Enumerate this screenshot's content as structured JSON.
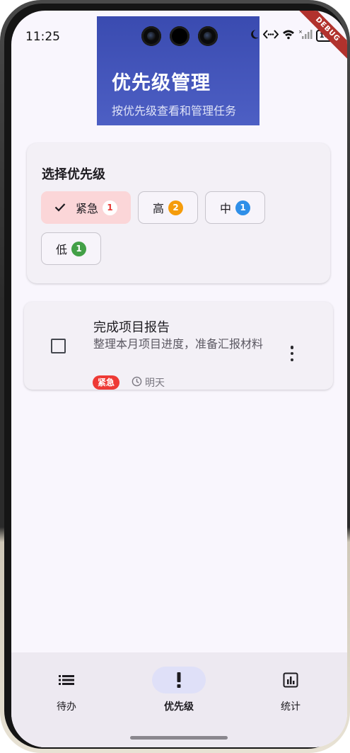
{
  "status_bar": {
    "time": "11:25",
    "battery": "100",
    "debug_banner": "DEBUG"
  },
  "header": {
    "title": "优先级管理",
    "subtitle": "按优先级查看和管理任务"
  },
  "filter": {
    "title": "选择优先级",
    "chips": [
      {
        "label": "紧急",
        "count": "1",
        "selected": true,
        "badge_color": "#ffffff",
        "badge_text_color": "#e53935"
      },
      {
        "label": "高",
        "count": "2",
        "selected": false,
        "badge_color": "#f59c0b",
        "badge_text_color": "#ffffff"
      },
      {
        "label": "中",
        "count": "1",
        "selected": false,
        "badge_color": "#2f8fe8",
        "badge_text_color": "#ffffff"
      },
      {
        "label": "低",
        "count": "1",
        "selected": false,
        "badge_color": "#43a047",
        "badge_text_color": "#ffffff"
      }
    ]
  },
  "task": {
    "title": "完成项目报告",
    "description": "整理本月项目进度，准备汇报材料",
    "priority_tag": "紧急",
    "due": "明天",
    "completed": false
  },
  "nav": {
    "items": [
      {
        "label": "待办",
        "icon": "list-icon",
        "active": false
      },
      {
        "label": "优先级",
        "icon": "priority-high-icon",
        "active": true
      },
      {
        "label": "统计",
        "icon": "bar-chart-icon",
        "active": false
      }
    ]
  },
  "colors": {
    "header_gradient_start": "#3a4bb0",
    "header_gradient_end": "#4d5fc4",
    "urgent_red": "#ee3a35",
    "selected_chip_bg": "#fbd6d8",
    "nav_active_pill": "#dfe0f8"
  }
}
